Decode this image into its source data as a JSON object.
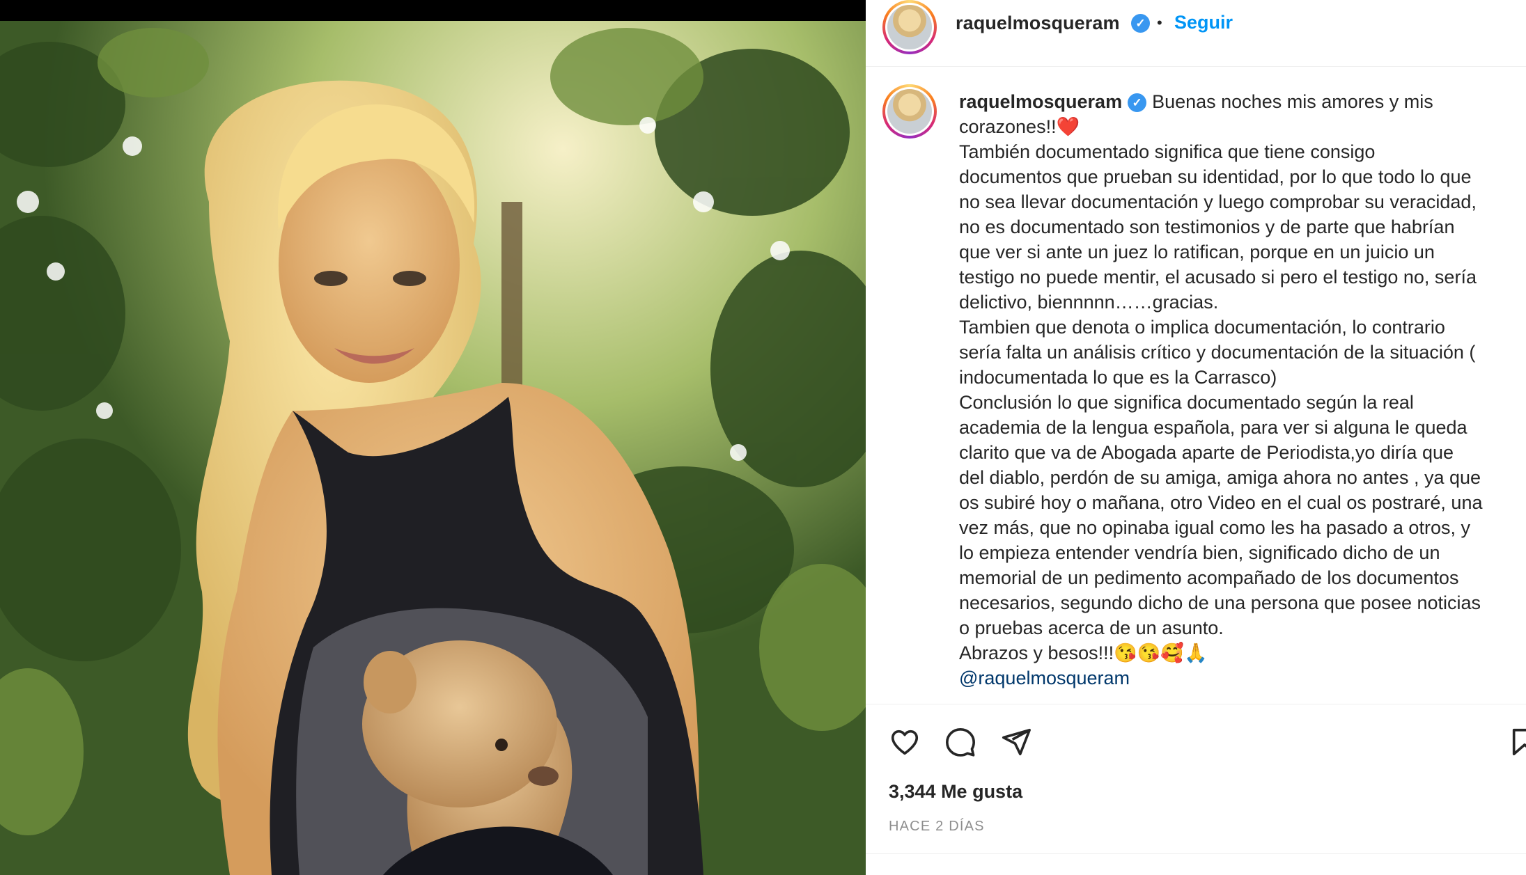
{
  "post": {
    "username": "raquelmosqueram",
    "follow_label": "Seguir",
    "separator": "•",
    "verified_glyph": "✓"
  },
  "caption": {
    "username": "raquelmosqueram",
    "lines": [
      "Buenas noches mis amores y mis",
      "corazones!!❤️",
      "También documentado significa que tiene consigo",
      "documentos que prueban su identidad, por lo que todo lo que",
      "no sea llevar documentación y luego comprobar su veracidad,",
      "no es documentado son testimonios y de parte que habrían",
      "que ver si ante un juez lo ratifican, porque en un juicio un",
      "testigo no puede mentir, el acusado si pero el testigo no, sería",
      "delictivo, biennnnn……gracias.",
      "Tambien que denota o implica documentación, lo contrario",
      "sería falta un análisis crítico y documentación de la situación (",
      "indocumentada lo que es la Carrasco)",
      "Conclusión lo que significa documentado según la real",
      "academia de la lengua española, para ver si alguna le queda",
      "clarito que va de Abogada aparte de Periodista,yo diría que",
      "del diablo, perdón de su amiga, amiga ahora no antes , ya que",
      "os subiré hoy o mañana, otro Video en el cual os postraré, una",
      "vez más, que no opinaba igual como les ha pasado a otros, y",
      "lo empieza entender vendría bien, significado dicho de un",
      "memorial de un pedimento acompañado de los documentos",
      "necesarios, segundo dicho de una persona que posee noticias",
      "o pruebas acerca de un asunto.",
      "Abrazos y besos!!!😘😘🥰🙏"
    ],
    "mention": "@raquelmosqueram"
  },
  "engagement": {
    "likes": "3,344 Me gusta",
    "time": "HACE 2 DÍAS"
  },
  "icons": {
    "like": "heart-icon",
    "comment": "comment-icon",
    "share": "share-icon",
    "save": "bookmark-icon"
  },
  "colors": {
    "follow": "#0095f6",
    "verified": "#3897f0",
    "text": "#262626",
    "muted": "#8e8e8e",
    "mention": "#00376b"
  }
}
